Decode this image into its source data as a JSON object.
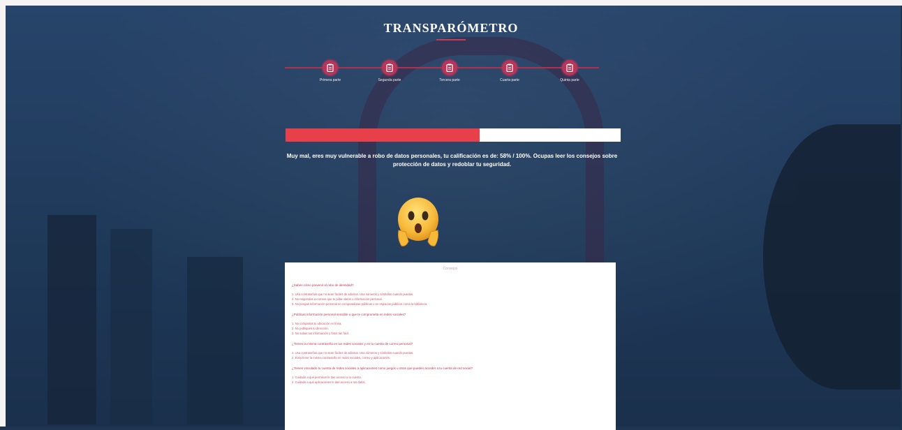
{
  "app": {
    "title": "TRANSPARÓMETRO"
  },
  "stepper": {
    "steps": [
      {
        "label": "Primera parte"
      },
      {
        "label": "Segunda parte"
      },
      {
        "label": "Tercera parte"
      },
      {
        "label": "Cuarta parte"
      },
      {
        "label": "Quinta parte"
      }
    ]
  },
  "progress": {
    "value_percent": 58,
    "fill_color": "#e8404a",
    "track_color": "#ffffff"
  },
  "result": {
    "message": "Muy mal, eres muy vulnerable a robo de datos personales, tu calificación es de: 58% / 100%. Ocupas leer los consejos sobre protección de datos y redoblar tu seguridad."
  },
  "emoji": {
    "icon": "shocked-face-emoji"
  },
  "advice": {
    "title": "Consejos",
    "items": [
      {
        "question": "¿Sabes cómo prevenir el robo de identidad?",
        "answers": [
          "1. Usa contraseñas que no sean fáciles de adivinar. Usa números y símbolos cuando puedas.",
          "2. No respondas a correos que te pidan datos o información personal.",
          "3. No pongas información personal en computadoras públicas o en espacios públicos como la biblioteca."
        ]
      },
      {
        "question": "¿Publicas información personal sensible o que te comprometa en redes sociales?",
        "answers": [
          "1. No compartas tu ubicación en línea.",
          "2. No publiques tu dirección.",
          "3. No subas tus información y fotos tan fácil."
        ]
      },
      {
        "question": "¿Tienes la misma contraseña en tus redes sociales y en tu cuenta de correo personal?",
        "answers": [
          "1. Usa contraseñas que no sean fáciles de adivinar. Usa números y símbolos cuando puedas.",
          "2. Evita tener la misma contraseña en redes sociales, correo y aplicaciones."
        ]
      },
      {
        "question": "¿Tienes vinculado tu cuenta de redes sociales a aplicaciones como juegos u otras que pueden acceder a tu cuenta de red social?",
        "answers": [
          "1. Cuidado a qué permisos le das acceso a tu cuenta.",
          "2. Cuidado a qué aplicaciones le das acceso a tus datos."
        ]
      }
    ]
  }
}
